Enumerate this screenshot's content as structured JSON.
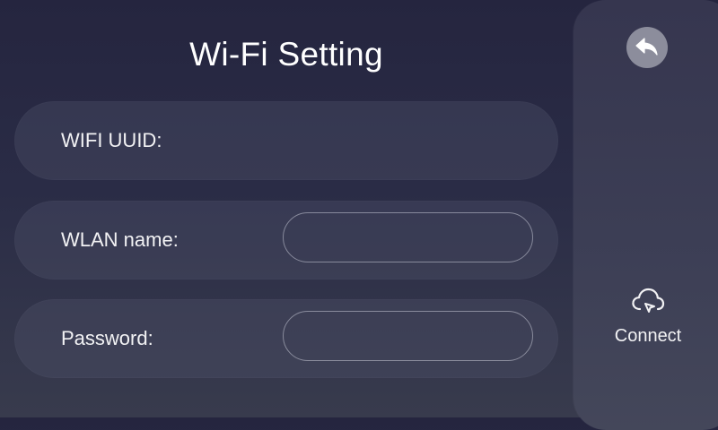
{
  "page": {
    "title": "Wi-Fi Setting"
  },
  "form": {
    "uuid": {
      "label": "WIFI UUID:",
      "value": ""
    },
    "wlan": {
      "label": "WLAN name:",
      "value": "",
      "placeholder": ""
    },
    "password": {
      "label": "Password:",
      "value": "",
      "placeholder": ""
    }
  },
  "sidebar": {
    "back_icon": "back-arrow-icon",
    "connect_icon": "cloud-icon",
    "connect_label": "Connect"
  },
  "colors": {
    "background": "#2a2c46",
    "row": "#3a3c52",
    "sidebar": "#3c3e55",
    "back_button": "#8c8d9c",
    "text": "#ffffff"
  }
}
